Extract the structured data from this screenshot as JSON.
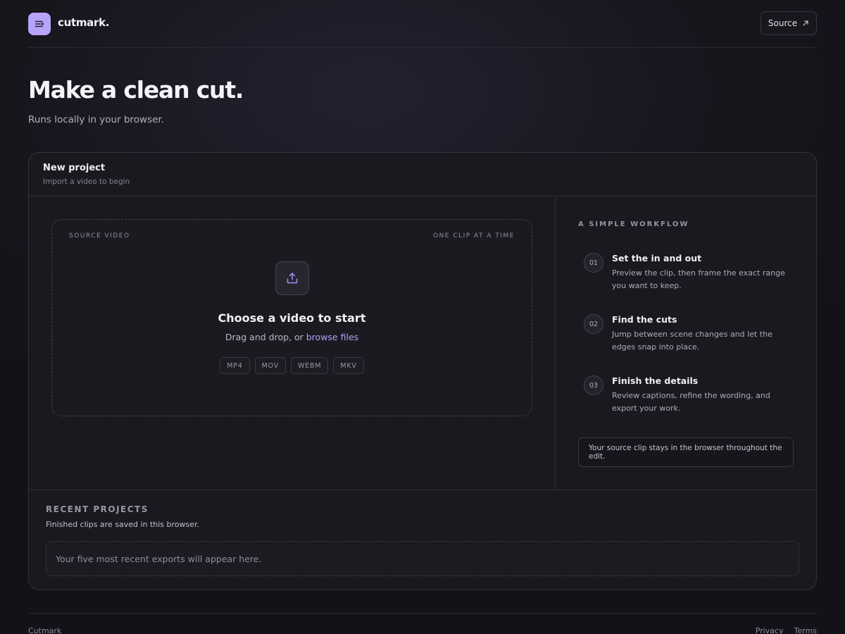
{
  "brand": {
    "name": "cutmark.",
    "icon": "menu-lines-icon",
    "accent": "#b8a4f7"
  },
  "header": {
    "source_label": "Source",
    "source_icon": "external-arrow-icon"
  },
  "hero": {
    "title": "Make a clean cut.",
    "subtitle": "Runs locally in your browser."
  },
  "panel": {
    "title": "New project",
    "subtitle": "Import a video to begin",
    "dropzone": {
      "label_left": "SOURCE VIDEO",
      "label_right": "ONE CLIP AT A TIME",
      "icon": "upload-icon",
      "title": "Choose a video to start",
      "prompt": "Drag and drop, or",
      "link": "browse files",
      "formats": [
        "MP4",
        "MOV",
        "WEBM",
        "MKV"
      ]
    },
    "workflow": {
      "title": "A SIMPLE WORKFLOW",
      "steps": [
        {
          "num": "01",
          "title": "Set the in and out",
          "desc": "Preview the clip, then frame the exact range you want to keep."
        },
        {
          "num": "02",
          "title": "Find the cuts",
          "desc": "Jump between scene changes and let the edges snap into place."
        },
        {
          "num": "03",
          "title": "Finish the details",
          "desc": "Review captions, refine the wording, and export your work."
        }
      ],
      "note": "Your source clip stays in the browser throughout the edit."
    },
    "recent": {
      "title": "RECENT PROJECTS",
      "subtitle": "Finished clips are saved in this browser.",
      "empty": "Your five most recent exports will appear here."
    }
  },
  "footer": {
    "brand": "Cutmark",
    "links": [
      "Privacy",
      "Terms"
    ]
  }
}
